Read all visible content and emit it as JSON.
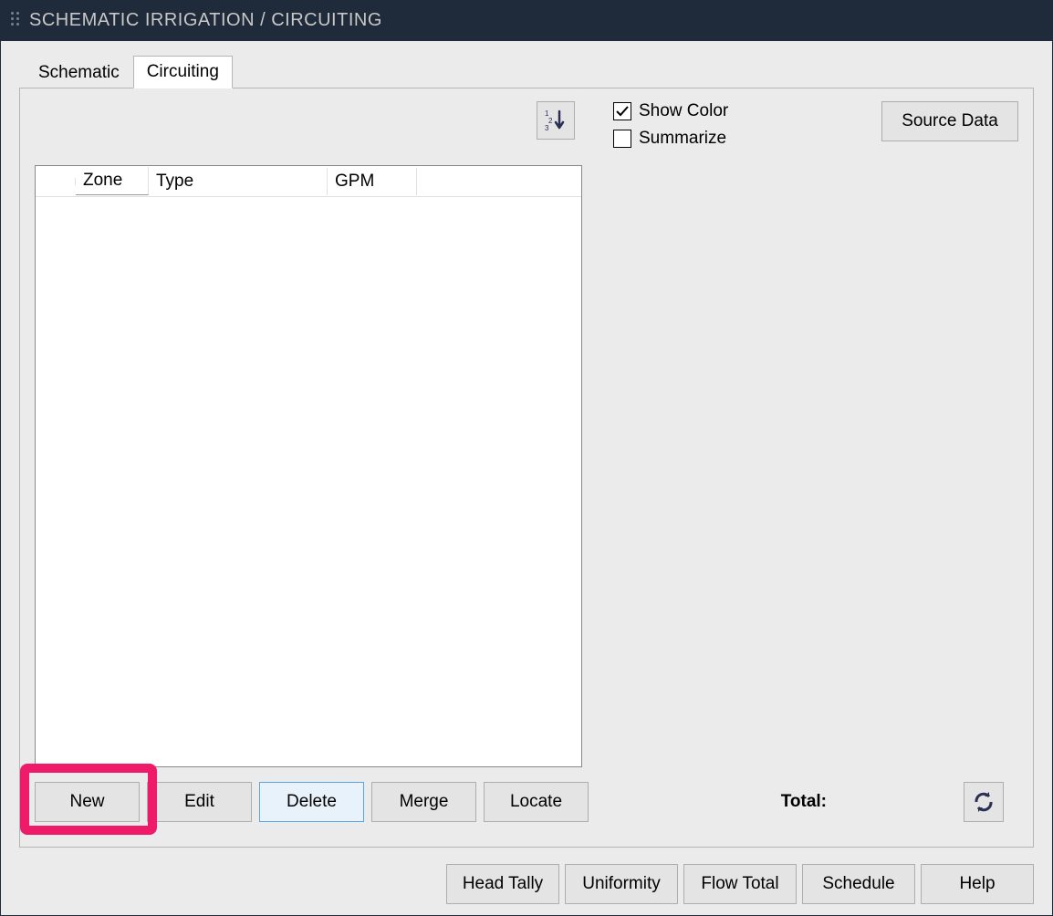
{
  "title": "SCHEMATIC IRRIGATION / CIRCUITING",
  "tabs": {
    "schematic": "Schematic",
    "circuiting": "Circuiting"
  },
  "checkboxes": {
    "show_color": {
      "label": "Show Color",
      "checked": true
    },
    "summarize": {
      "label": "Summarize",
      "checked": false
    }
  },
  "buttons": {
    "source_data": "Source Data",
    "new": "New",
    "edit": "Edit",
    "delete": "Delete",
    "merge": "Merge",
    "locate": "Locate",
    "head_tally": "Head Tally",
    "uniformity": "Uniformity",
    "flow_total": "Flow Total",
    "schedule": "Schedule",
    "help": "Help"
  },
  "grid": {
    "columns": {
      "zone": "Zone",
      "type": "Type",
      "gpm": "GPM"
    },
    "rows": []
  },
  "labels": {
    "total": "Total:"
  }
}
